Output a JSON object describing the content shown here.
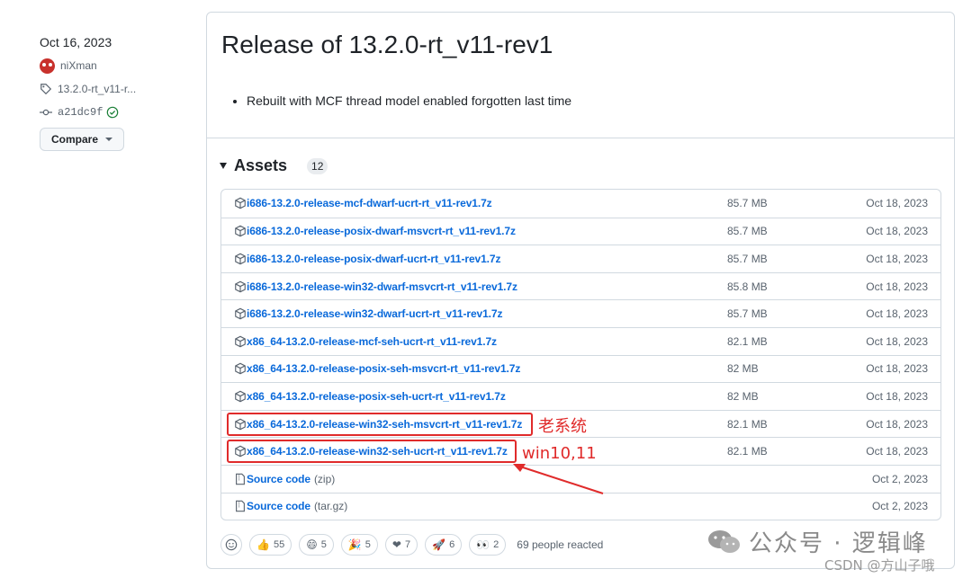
{
  "sidebar": {
    "date": "Oct 16, 2023",
    "author": "niXman",
    "tag": "13.2.0-rt_v11-r...",
    "commit": "a21dc9f",
    "compare_label": "Compare"
  },
  "release": {
    "title": "Release of 13.2.0-rt_v11-rev1",
    "notes": [
      "Rebuilt with MCF thread model enabled forgotten last time"
    ]
  },
  "assets": {
    "title": "Assets",
    "count": "12",
    "rows": [
      {
        "name": "i686-13.2.0-release-mcf-dwarf-ucrt-rt_v11-rev1.7z",
        "suffix": "",
        "size": "85.7 MB",
        "date": "Oct 18, 2023",
        "icon": "package-icon"
      },
      {
        "name": "i686-13.2.0-release-posix-dwarf-msvcrt-rt_v11-rev1.7z",
        "suffix": "",
        "size": "85.7 MB",
        "date": "Oct 18, 2023",
        "icon": "package-icon"
      },
      {
        "name": "i686-13.2.0-release-posix-dwarf-ucrt-rt_v11-rev1.7z",
        "suffix": "",
        "size": "85.7 MB",
        "date": "Oct 18, 2023",
        "icon": "package-icon"
      },
      {
        "name": "i686-13.2.0-release-win32-dwarf-msvcrt-rt_v11-rev1.7z",
        "suffix": "",
        "size": "85.8 MB",
        "date": "Oct 18, 2023",
        "icon": "package-icon"
      },
      {
        "name": "i686-13.2.0-release-win32-dwarf-ucrt-rt_v11-rev1.7z",
        "suffix": "",
        "size": "85.7 MB",
        "date": "Oct 18, 2023",
        "icon": "package-icon"
      },
      {
        "name": "x86_64-13.2.0-release-mcf-seh-ucrt-rt_v11-rev1.7z",
        "suffix": "",
        "size": "82.1 MB",
        "date": "Oct 18, 2023",
        "icon": "package-icon"
      },
      {
        "name": "x86_64-13.2.0-release-posix-seh-msvcrt-rt_v11-rev1.7z",
        "suffix": "",
        "size": "82 MB",
        "date": "Oct 18, 2023",
        "icon": "package-icon"
      },
      {
        "name": "x86_64-13.2.0-release-posix-seh-ucrt-rt_v11-rev1.7z",
        "suffix": "",
        "size": "82 MB",
        "date": "Oct 18, 2023",
        "icon": "package-icon"
      },
      {
        "name": "x86_64-13.2.0-release-win32-seh-msvcrt-rt_v11-rev1.7z",
        "suffix": "",
        "size": "82.1 MB",
        "date": "Oct 18, 2023",
        "icon": "package-icon",
        "annotation": "老系统"
      },
      {
        "name": "x86_64-13.2.0-release-win32-seh-ucrt-rt_v11-rev1.7z",
        "suffix": "",
        "size": "82.1 MB",
        "date": "Oct 18, 2023",
        "icon": "package-icon",
        "annotation": "win10,11"
      },
      {
        "name": "Source code",
        "suffix": "(zip)",
        "size": "",
        "date": "Oct 2, 2023",
        "icon": "file-zip-icon"
      },
      {
        "name": "Source code",
        "suffix": "(tar.gz)",
        "size": "",
        "date": "Oct 2, 2023",
        "icon": "file-zip-icon"
      }
    ]
  },
  "reactions": {
    "items": [
      {
        "emoji": "👍",
        "count": "55"
      },
      {
        "emoji": "😄",
        "count": "5"
      },
      {
        "emoji": "🎉",
        "count": "5"
      },
      {
        "emoji": "❤",
        "count": "7"
      },
      {
        "emoji": "🚀",
        "count": "6"
      },
      {
        "emoji": "👀",
        "count": "2"
      }
    ],
    "summary": "69 people reacted"
  },
  "watermark": {
    "main": "公众号 · 逻辑峰",
    "footer": "CSDN @方山子哦"
  },
  "colors": {
    "link": "#0969da",
    "muted": "#59636e",
    "border": "#d1d9e0",
    "annotation": "#e02b2b"
  }
}
